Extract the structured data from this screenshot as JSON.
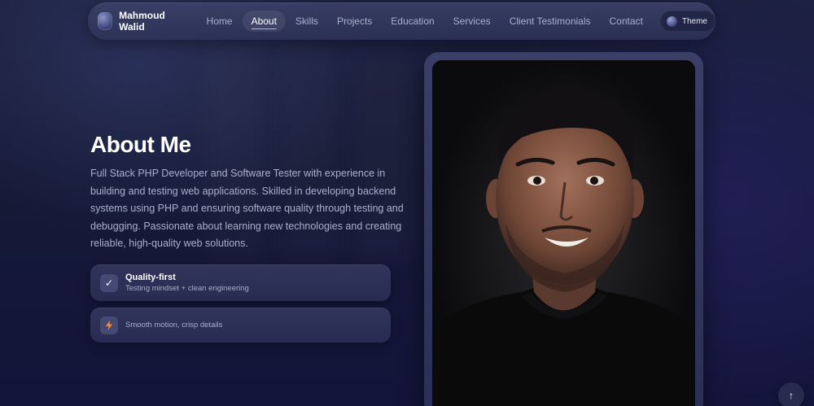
{
  "header": {
    "brand_name": "Mahmoud Walid",
    "nav": [
      "Home",
      "About",
      "Skills",
      "Projects",
      "Education",
      "Services",
      "Client Testimonials",
      "Contact"
    ],
    "active": "About",
    "theme_label": "Theme"
  },
  "about": {
    "title": "About Me",
    "description": "Full Stack PHP Developer and Software Tester with experience in building and testing web applications. Skilled in developing backend systems using PHP and ensuring software quality through testing and debugging. Passionate about learning new technologies and creating reliable, high-quality web solutions.",
    "cards": [
      {
        "icon": "check-icon",
        "glyph": "✓",
        "title": "Quality-first",
        "subtitle": "Testing mindset + clean engineering"
      },
      {
        "icon": "lightning-icon",
        "glyph": "⚡",
        "subtitle": "Smooth motion, crisp details"
      }
    ]
  },
  "scroll_top": {
    "icon": "arrow-up-icon",
    "glyph": "↑"
  },
  "colors": {
    "background": "#161a36",
    "card": "#2f3360",
    "accent_lightning": "#f08a3c"
  }
}
